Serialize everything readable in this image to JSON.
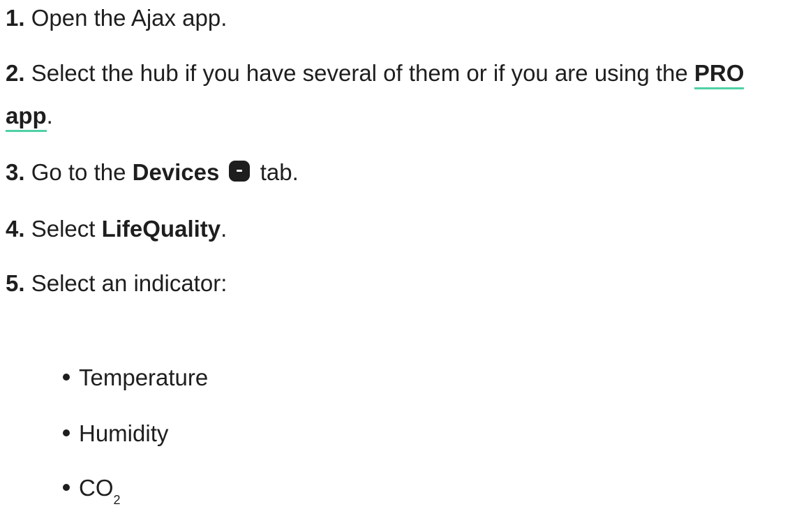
{
  "steps": [
    {
      "num": "1.",
      "text": " Open the Ajax app."
    },
    {
      "num": "2.",
      "text_before": " Select the hub if you have several of them or if you are using the ",
      "link_line1": "PRO",
      "link_line2": "app",
      "text_after": "."
    },
    {
      "num": "3.",
      "text_before": " Go to the ",
      "bold": "Devices",
      "text_after": " tab.",
      "icon": "devices-icon"
    },
    {
      "num": "4.",
      "text_before": " Select ",
      "bold": "LifeQuality",
      "text_after": "."
    },
    {
      "num": "5.",
      "text": " Select an indicator:"
    }
  ],
  "bullets": [
    {
      "text": "Temperature"
    },
    {
      "text": "Humidity"
    },
    {
      "text": "CO",
      "sub": "2"
    }
  ],
  "colors": {
    "text": "#1e1e1e",
    "link_underline": "#4fd1a5",
    "background": "#ffffff"
  }
}
